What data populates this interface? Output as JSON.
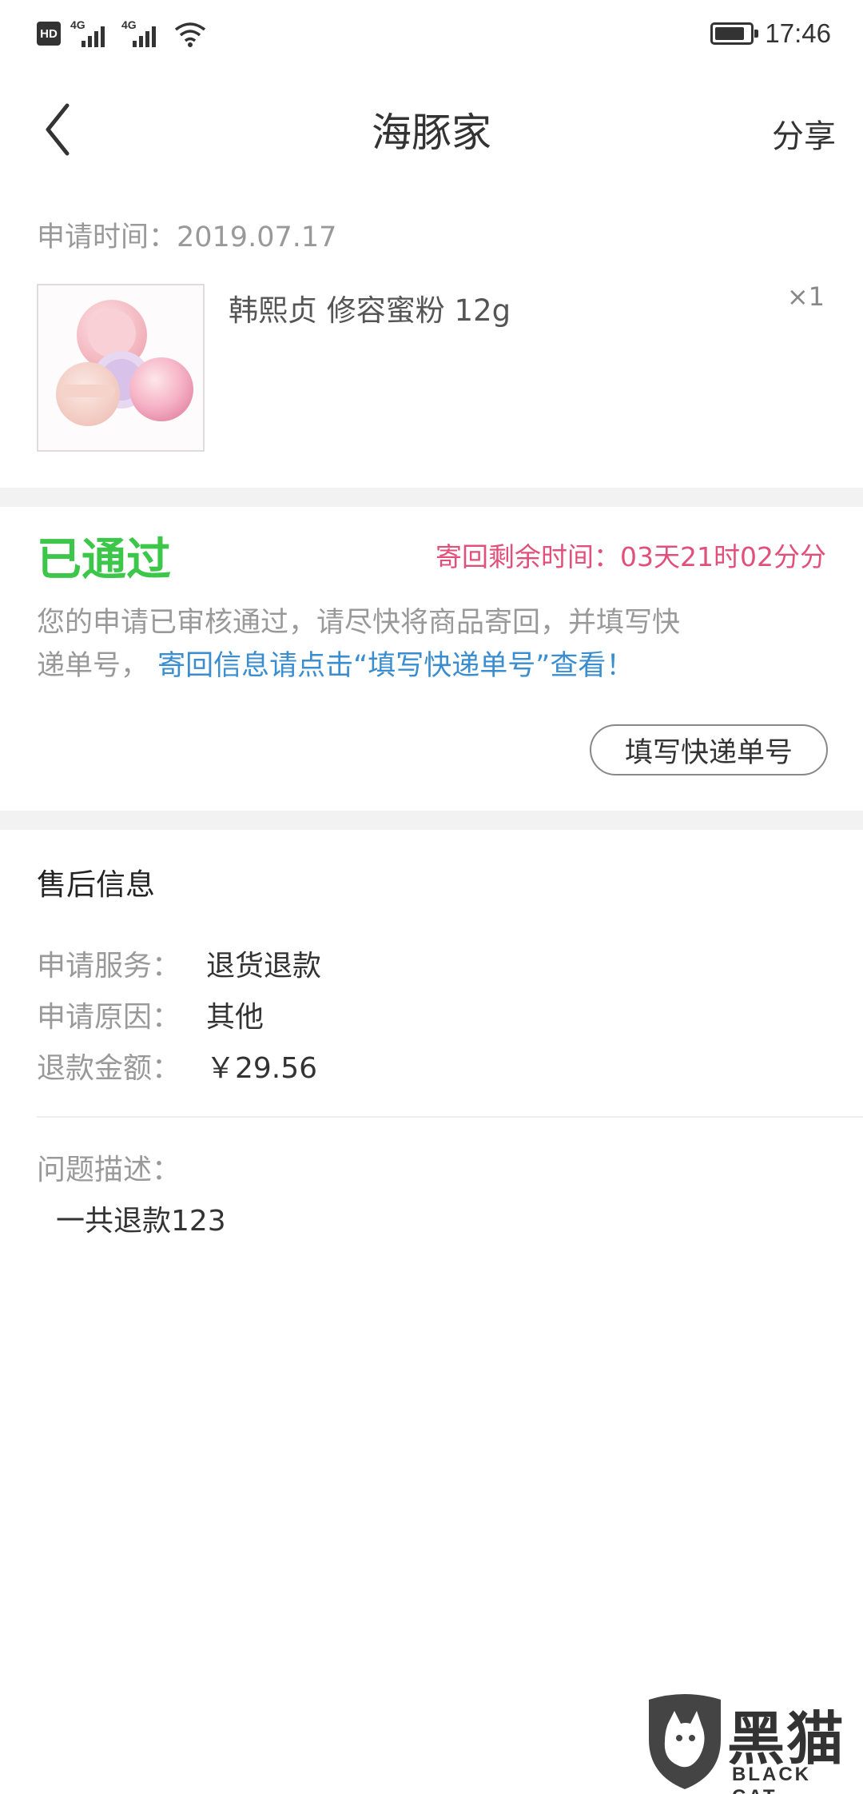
{
  "status_bar": {
    "hd_badge": "HD",
    "network_1": "4G",
    "network_2": "4G",
    "battery_level": 0.85,
    "time": "17:46"
  },
  "header": {
    "title": "海豚家",
    "share_label": "分享",
    "back_icon": "chevron-left-icon"
  },
  "application": {
    "apply_time": "申请时间：2019.07.17",
    "product": {
      "name": "韩熙贞 修容蜜粉 12g",
      "quantity": "×1"
    }
  },
  "status": {
    "title": "已通过",
    "countdown": "寄回剩余时间：03天21时02分分",
    "notice_line1": "您的申请已审核通过，请尽快将商品寄回，并填写快",
    "notice_line2_prefix": "递单号，",
    "notice_line2_link": "寄回信息请点击“填写快递单号”查看！",
    "fill_button_label": "填写快递单号"
  },
  "after_sale": {
    "section_title": "售后信息",
    "rows": [
      {
        "label": "申请服务：",
        "value": "退货退款"
      },
      {
        "label": "申请原因：",
        "value": "其他"
      },
      {
        "label": "退款金额：",
        "value": "￥29.56"
      }
    ],
    "problem_label": "问题描述：",
    "problem_text": "一共退款123"
  },
  "watermark": {
    "cn_text": "黑猫",
    "en_text": "BLACK CAT"
  },
  "colors": {
    "approved_green": "#3cc74a",
    "countdown_pink": "#e0507a",
    "link_blue": "#3a8ed0",
    "muted_gray": "#999999",
    "band_gray": "#f2f2f2"
  }
}
